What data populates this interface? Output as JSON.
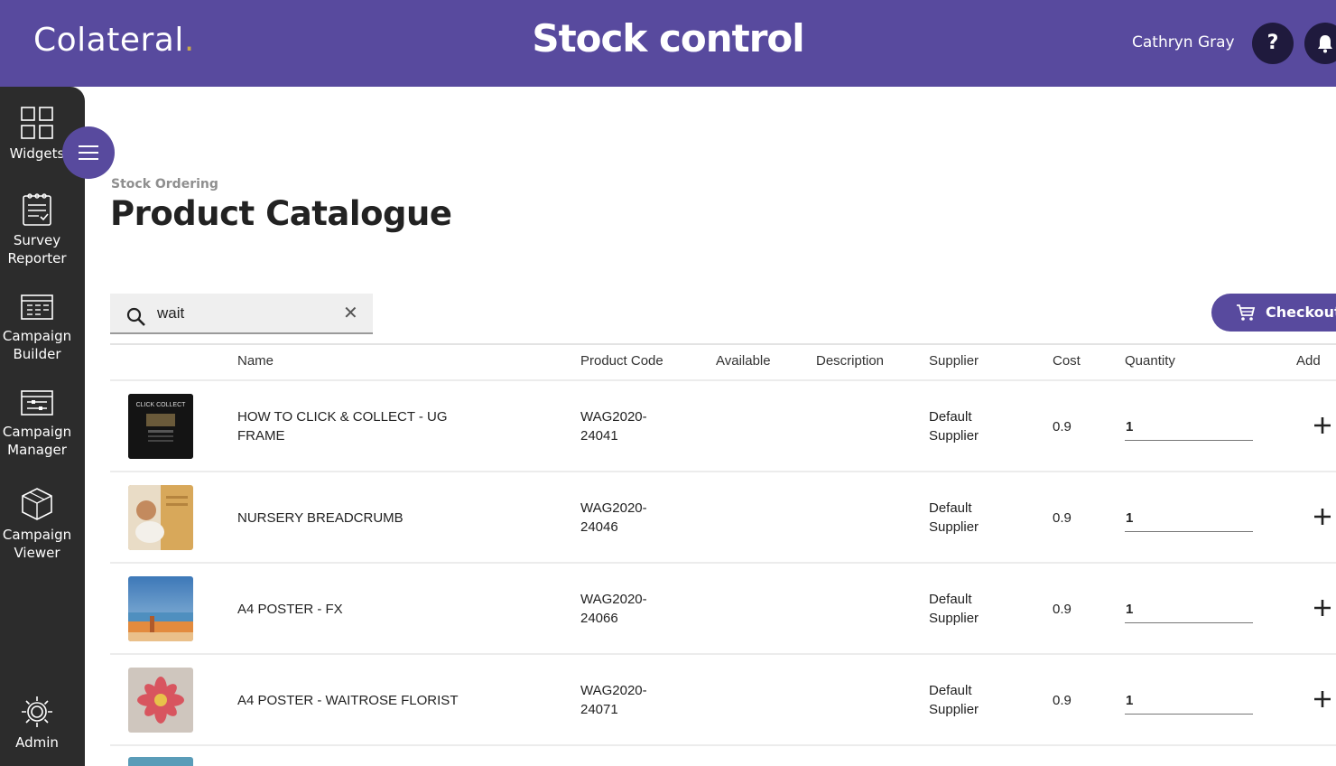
{
  "header": {
    "logo": "Colateral",
    "logo_dot": ".",
    "title": "Stock control",
    "user_name": "Cathryn Gray",
    "help_label": "?",
    "help_icon": "question-icon",
    "notification_icon": "bell-icon"
  },
  "sidebar": {
    "items": [
      {
        "label": "Widgets",
        "icon": "grid-icon"
      },
      {
        "label": "Survey Reporter",
        "icon": "clipboard-icon"
      },
      {
        "label": "Campaign Builder",
        "icon": "calendar-grid-icon"
      },
      {
        "label": "Campaign Manager",
        "icon": "panel-icon"
      },
      {
        "label": "Campaign Viewer",
        "icon": "cube-icon"
      },
      {
        "label": "Admin",
        "icon": "gear-icon"
      }
    ],
    "menu_icon": "hamburger-icon"
  },
  "page": {
    "breadcrumb": "Stock Ordering",
    "title": "Product Catalogue"
  },
  "search": {
    "value": "wait",
    "clear_icon": "close-icon"
  },
  "checkout": {
    "label": "Checkout",
    "icon": "cart-icon"
  },
  "table": {
    "columns": [
      "Name",
      "Product Code",
      "Available",
      "Description",
      "Supplier",
      "Cost",
      "Quantity",
      "Add"
    ],
    "rows": [
      {
        "name": "HOW TO CLICK & COLLECT - UG FRAME",
        "code": "WAG2020- 24041",
        "available": "",
        "description": "",
        "supplier": "Default Supplier",
        "cost": "0.9",
        "quantity": "1",
        "thumb_text": "CLICK COLLECT"
      },
      {
        "name": "NURSERY BREADCRUMB",
        "code": "WAG2020- 24046",
        "available": "",
        "description": "",
        "supplier": "Default Supplier",
        "cost": "0.9",
        "quantity": "1"
      },
      {
        "name": "A4 POSTER - FX",
        "code": "WAG2020- 24066",
        "available": "",
        "description": "",
        "supplier": "Default Supplier",
        "cost": "0.9",
        "quantity": "1"
      },
      {
        "name": "A4 POSTER - WAITROSE FLORIST",
        "code": "WAG2020- 24071",
        "available": "",
        "description": "",
        "supplier": "Default Supplier",
        "cost": "0.9",
        "quantity": "1"
      }
    ]
  },
  "colors": {
    "brand_purple": "#584a9e",
    "sidebar_dark": "#2c2c2c",
    "icon_dark": "#1f1a3d"
  }
}
